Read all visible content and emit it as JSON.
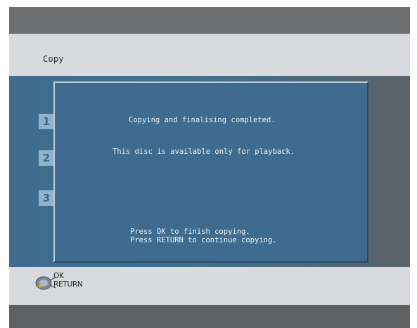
{
  "header": {
    "title": "Copy"
  },
  "steps": [
    "1",
    "2",
    "3"
  ],
  "dialog": {
    "message_line1": "Copying and finalising completed.",
    "message_line2": "This disc is available only for playback.",
    "hint_line1": "Press OK to finish copying.",
    "hint_line2": "Press RETURN to continue copying."
  },
  "footer": {
    "ok_label": "OK",
    "return_label": "RETURN",
    "icon": "remote-dial-icon"
  },
  "colors": {
    "header_bg": "#d9dadd",
    "dialog_bg": "#3e6b8f",
    "step_bg": "#8fb3cc",
    "dial_accent": "#e3a51a"
  }
}
